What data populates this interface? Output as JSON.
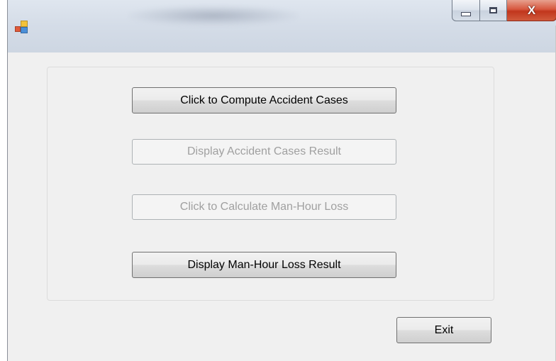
{
  "window": {
    "title": "",
    "caption": {
      "minimize": "",
      "maximize": "",
      "close": "X"
    }
  },
  "buttons": {
    "compute_accident": {
      "label": "Click to Compute Accident Cases",
      "enabled": true
    },
    "display_accident": {
      "label": "Display Accident Cases Result",
      "enabled": false
    },
    "calculate_manhour": {
      "label": "Click to Calculate Man-Hour Loss",
      "enabled": false
    },
    "display_manhour": {
      "label": "Display Man-Hour Loss Result",
      "enabled": true
    },
    "exit": {
      "label": "Exit",
      "enabled": true
    }
  },
  "colors": {
    "close_button": "#d05a3c",
    "disabled_text": "#a0a0a0",
    "form_background": "#f0f0f0"
  },
  "icons": {
    "app": "windows-forms-app-icon",
    "minimize": "minimize-icon",
    "maximize": "maximize-icon",
    "close": "close-icon"
  }
}
